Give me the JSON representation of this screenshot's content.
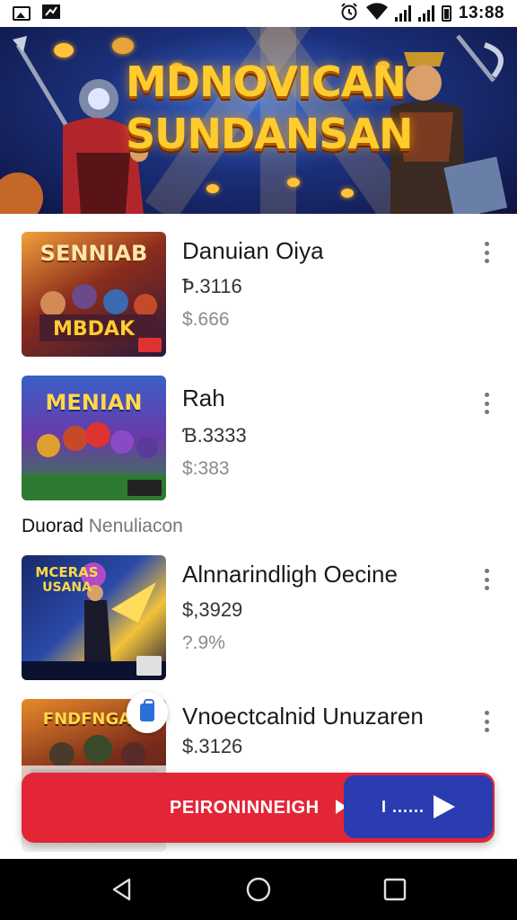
{
  "status_bar": {
    "time": "13:88"
  },
  "banner": {
    "title_line1": "MDNOVICAN",
    "title_line2": "SUNDANSAN"
  },
  "games": [
    {
      "title": "Danuian Oiya",
      "price": "Ꝥ.3116",
      "sub_price": "$.666",
      "thumb_text_1": "SENNIAB",
      "thumb_text_2": "MBDAK"
    },
    {
      "title": "Rah",
      "price": "Ɓ.3333",
      "sub_price": "$:383",
      "thumb_text_1": "MENIAN",
      "thumb_text_2": ""
    }
  ],
  "section": {
    "label_bold": "Duorad",
    "label_light": "Nenuliacon"
  },
  "games_section2": [
    {
      "title": "Alnnarindligh Oecine",
      "price": "$,3929",
      "sub_price": "?.9%",
      "thumb_text_1": "MCERAS",
      "thumb_text_2": "USANA"
    },
    {
      "title": "Vnoectcalnid Unuzaren",
      "price": "$.3126",
      "sub_price": "",
      "thumb_text_1": "FNDFNGAN",
      "thumb_text_2": ""
    }
  ],
  "cta": {
    "label": "PEIRONINNEIGH",
    "go_label": "I ......"
  },
  "colors": {
    "cta_red": "#e32636",
    "cta_blue": "#2a3cb0",
    "banner_gold": "#ffcc2e"
  },
  "icons": {
    "status_left": [
      "image-icon",
      "app-icon"
    ],
    "status_right": [
      "alarm-icon",
      "wifi-icon",
      "signal-icon",
      "signal-icon",
      "battery-icon"
    ],
    "nav": [
      "back-icon",
      "home-icon",
      "recents-icon"
    ]
  }
}
